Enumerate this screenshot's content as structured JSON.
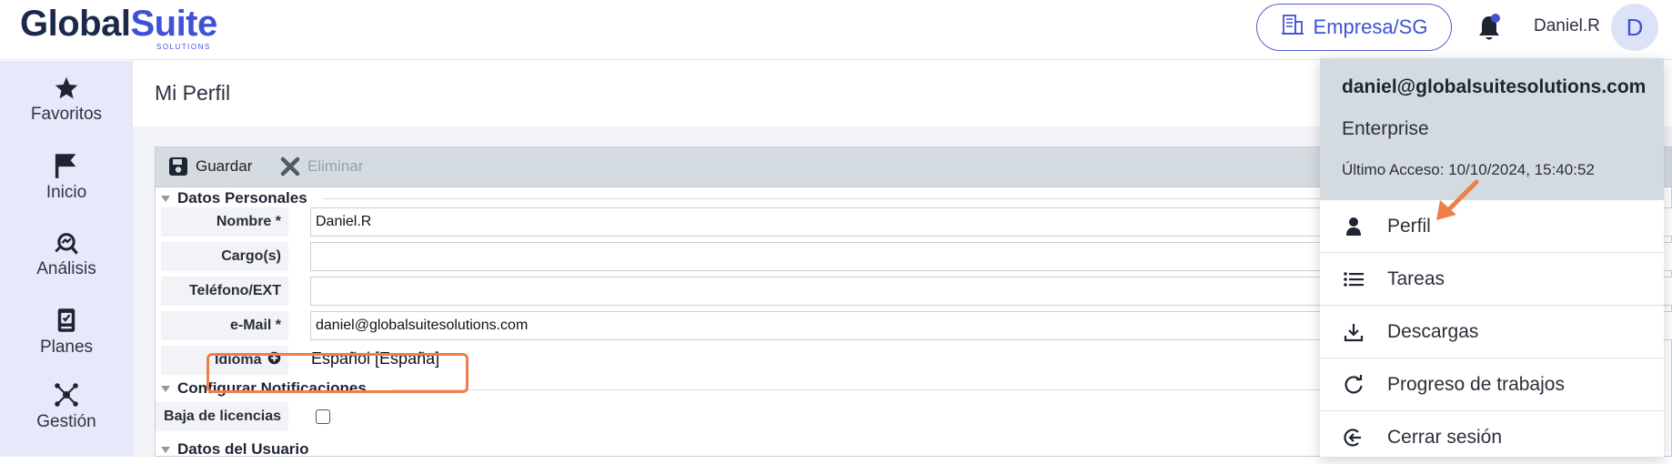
{
  "header": {
    "logo_main_a": "Global",
    "logo_main_b": "Suite",
    "logo_sub": "SOLUTIONS",
    "company_label": "Empresa/SG",
    "user_name": "Daniel.R",
    "avatar_initial": "D"
  },
  "sidebar": {
    "items": [
      {
        "label": "Favoritos",
        "icon": "star-icon"
      },
      {
        "label": "Inicio",
        "icon": "flag-icon"
      },
      {
        "label": "Análisis",
        "icon": "analysis-icon"
      },
      {
        "label": "Planes",
        "icon": "plans-icon"
      },
      {
        "label": "Gestión",
        "icon": "network-icon"
      }
    ]
  },
  "main": {
    "page_title": "Mi Perfil",
    "toolbar": {
      "save_label": "Guardar",
      "delete_label": "Eliminar"
    },
    "sections": {
      "personal": "Datos Personales",
      "notifications": "Configurar Notificaciones",
      "user_data": "Datos del Usuario"
    },
    "fields": {
      "name_label": "Nombre *",
      "name_value": "Daniel.R",
      "role_label": "Cargo(s)",
      "role_value": "",
      "phone_label": "Teléfono/EXT",
      "phone_value": "",
      "email_label": "e-Mail *",
      "email_value": "daniel@globalsuitesolutions.com",
      "language_label": "Idioma",
      "language_value": "Español [España]",
      "license_label": "Baja de licencias",
      "license_checked": false
    }
  },
  "dropdown": {
    "email": "daniel@globalsuitesolutions.com",
    "plan": "Enterprise",
    "last_access": "Último Acceso: 10/10/2024, 15:40:52",
    "items": [
      {
        "label": "Perfil",
        "icon": "person-icon"
      },
      {
        "label": "Tareas",
        "icon": "list-icon"
      },
      {
        "label": "Descargas",
        "icon": "download-icon"
      },
      {
        "label": "Progreso de trabajos",
        "icon": "progress-icon"
      },
      {
        "label": "Cerrar sesión",
        "icon": "logout-icon"
      }
    ]
  },
  "colors": {
    "accent": "#3f51d6",
    "sidebar_bg": "#e5e9f9",
    "highlight": "#ef7f4a",
    "dropdown_header_bg": "#d4dbe0"
  }
}
